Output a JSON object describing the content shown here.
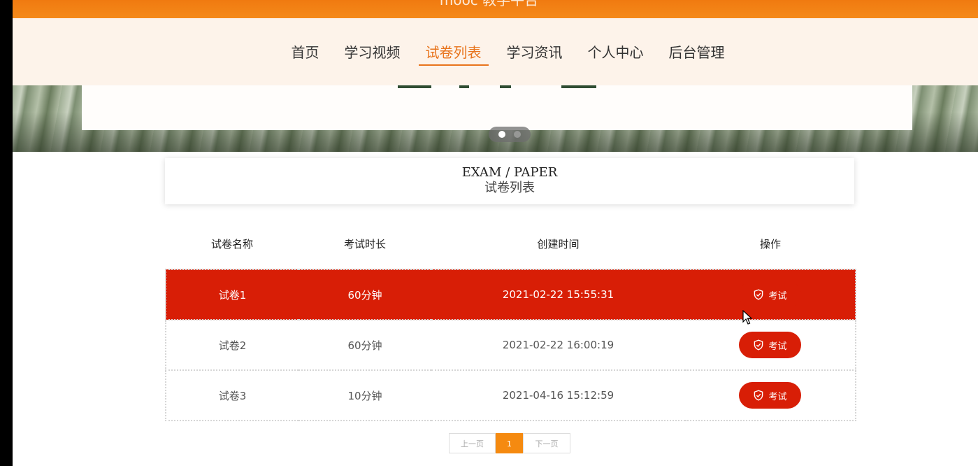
{
  "app": {
    "title": "mooc 教学平台"
  },
  "nav": {
    "items": [
      {
        "label": "首页",
        "active": false
      },
      {
        "label": "学习视频",
        "active": false
      },
      {
        "label": "试卷列表",
        "active": true
      },
      {
        "label": "学习资讯",
        "active": false
      },
      {
        "label": "个人中心",
        "active": false
      },
      {
        "label": "后台管理",
        "active": false
      }
    ]
  },
  "carousel": {
    "slide_count": 2,
    "active_index": 0
  },
  "section": {
    "title_en": "EXAM / PAPER",
    "title_zh": "试卷列表"
  },
  "table": {
    "headers": [
      "试卷名称",
      "考试时长",
      "创建时间",
      "操作"
    ],
    "rows": [
      {
        "name": "试卷1",
        "duration": "60分钟",
        "created": "2021-02-22 15:55:31",
        "action": "考试"
      },
      {
        "name": "试卷2",
        "duration": "60分钟",
        "created": "2021-02-22 16:00:19",
        "action": "考试"
      },
      {
        "name": "试卷3",
        "duration": "10分钟",
        "created": "2021-04-16 15:12:59",
        "action": "考试"
      }
    ],
    "hovered_row": 0
  },
  "pagination": {
    "prev": "上一页",
    "current": "1",
    "next": "下一页"
  },
  "colors": {
    "brand": "#f58a10",
    "accent": "#d81e06",
    "nav_active": "#e8741c"
  },
  "icons": {
    "exam_button_icon": "shield-check-icon"
  }
}
